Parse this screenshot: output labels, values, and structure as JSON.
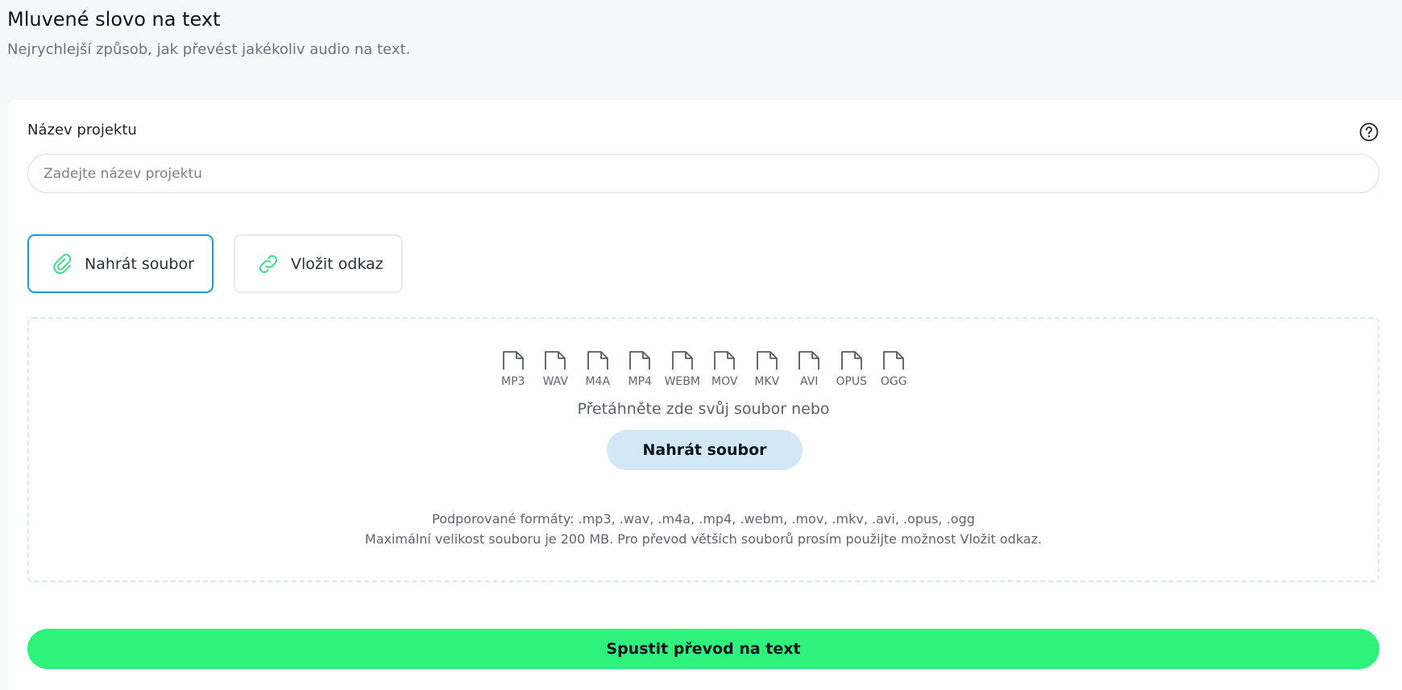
{
  "header": {
    "title": "Mluvené slovo na text",
    "subtitle": "Nejrychlejší způsob, jak převést jakékoliv audio na text."
  },
  "project": {
    "label": "Název projektu",
    "placeholder": "Zadejte název projektu",
    "value": ""
  },
  "modes": {
    "upload_label": "Nahrát soubor",
    "link_label": "Vložit odkaz",
    "selected": "upload"
  },
  "dropzone": {
    "formats": [
      "MP3",
      "WAV",
      "M4A",
      "MP4",
      "WEBM",
      "MOV",
      "MKV",
      "AVI",
      "OPUS",
      "OGG"
    ],
    "drop_text": "Přetáhněte zde svůj soubor nebo",
    "upload_button": "Nahrát soubor",
    "supported_formats": "Podporované formáty: .mp3, .wav, .m4a, .mp4, .webm, .mov, .mkv, .avi, .opus, .ogg",
    "max_size_note": "Maximální velikost souboru je 200 MB. Pro převod větších souborů prosím použijte možnost Vložit odkaz."
  },
  "submit": {
    "label": "Spustit převod na text"
  },
  "colors": {
    "accent_green": "#2ef27c",
    "selected_border": "#1a9be0",
    "upload_button_bg": "#d3e8f6",
    "icon_green": "#3ddc84"
  },
  "icons": {
    "help": "question-circle-icon",
    "upload_mode": "paperclip-icon",
    "link_mode": "link-icon",
    "format": "file-icon"
  }
}
